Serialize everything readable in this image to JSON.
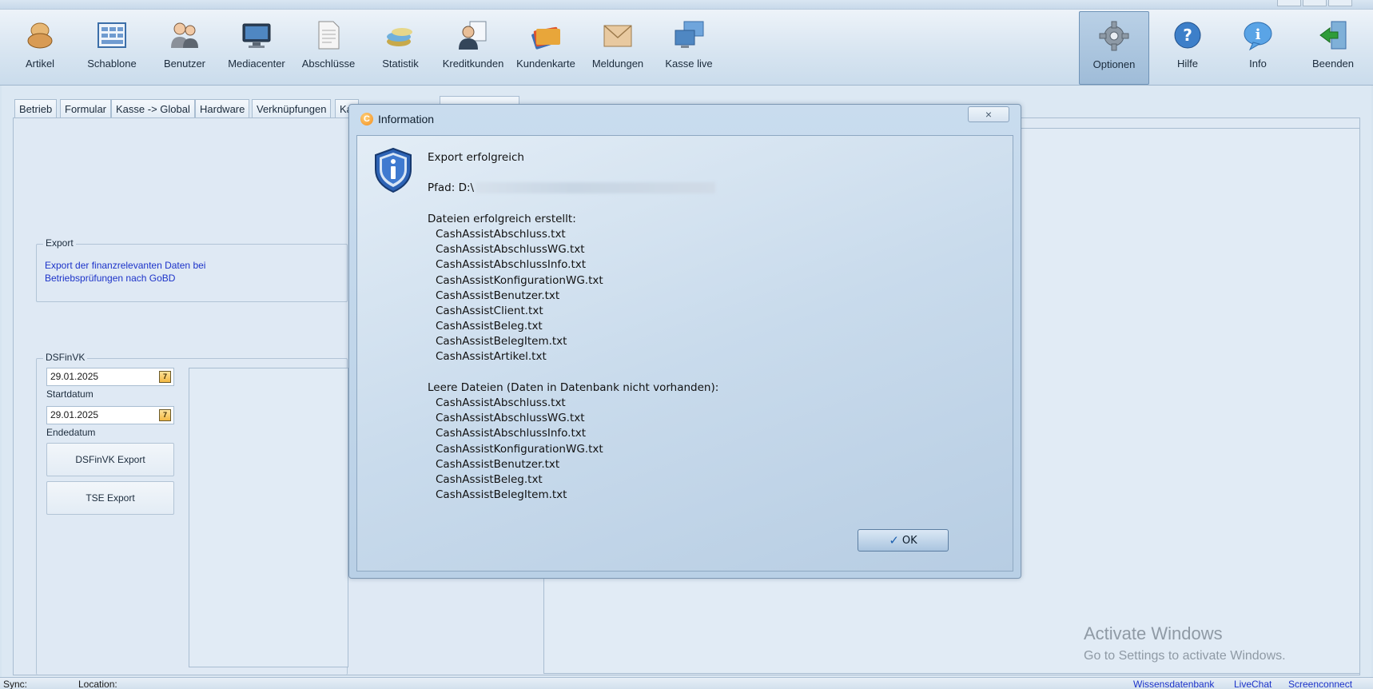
{
  "toolbar": {
    "items": [
      {
        "label": "Artikel",
        "icon": "bread-icon"
      },
      {
        "label": "Schablone",
        "icon": "template-icon"
      },
      {
        "label": "Benutzer",
        "icon": "users-icon"
      },
      {
        "label": "Mediacenter",
        "icon": "monitor-icon"
      },
      {
        "label": "Abschlüsse",
        "icon": "document-icon"
      },
      {
        "label": "Statistik",
        "icon": "chart-stack-icon"
      },
      {
        "label": "Kreditkunden",
        "icon": "customer-icon"
      },
      {
        "label": "Kundenkarte",
        "icon": "card-icon"
      },
      {
        "label": "Meldungen",
        "icon": "envelope-icon"
      },
      {
        "label": "Kasse live",
        "icon": "screens-icon"
      }
    ],
    "right_items": [
      {
        "label": "Optionen",
        "icon": "gear-icon",
        "active": true
      },
      {
        "label": "Hilfe",
        "icon": "help-icon"
      },
      {
        "label": "Info",
        "icon": "info-bubble-icon"
      },
      {
        "label": "Beenden",
        "icon": "exit-door-icon"
      }
    ]
  },
  "tabs": [
    "Betrieb",
    "Formular",
    "Kasse -> Global",
    "Hardware",
    "Verknüpfungen",
    "Ka"
  ],
  "export_group": {
    "title": "Export",
    "description_line1": "Export der finanzrelevanten Daten bei",
    "description_line2": "Betriebsprüfungen nach GoBD"
  },
  "dsfinvk_group": {
    "title": "DSFinVK",
    "start_value": "29.01.2025",
    "start_label": "Startdatum",
    "end_value": "29.01.2025",
    "end_label": "Endedatum",
    "calendar_glyph": "7",
    "export_button": "DSFinVK Export",
    "tse_button": "TSE Export"
  },
  "watermark": {
    "line1": "Activate Windows",
    "line2": "Go to Settings to activate Windows."
  },
  "statusbar": {
    "sync": "Sync:",
    "location": "Location:",
    "links": [
      "Wissensdatenbank",
      "LiveChat",
      "Screenconnect"
    ]
  },
  "dialog": {
    "title_icon_letter": "C",
    "title": "Information",
    "close_glyph": "×",
    "heading": "Export erfolgreich",
    "path_label": "Pfad: D:\\",
    "created_heading": "Dateien erfolgreich erstellt:",
    "created_files": [
      "CashAssistAbschluss.txt",
      "CashAssistAbschlussWG.txt",
      "CashAssistAbschlussInfo.txt",
      "CashAssistKonfigurationWG.txt",
      "CashAssistBenutzer.txt",
      "CashAssistClient.txt",
      "CashAssistBeleg.txt",
      "CashAssistBelegItem.txt",
      "CashAssistArtikel.txt"
    ],
    "empty_heading": "Leere Dateien (Daten in Datenbank nicht vorhanden):",
    "empty_files": [
      "CashAssistAbschluss.txt",
      "CashAssistAbschlussWG.txt",
      "CashAssistAbschlussInfo.txt",
      "CashAssistKonfigurationWG.txt",
      "CashAssistBenutzer.txt",
      "CashAssistBeleg.txt",
      "CashAssistBelegItem.txt"
    ],
    "ok_label": "OK"
  }
}
